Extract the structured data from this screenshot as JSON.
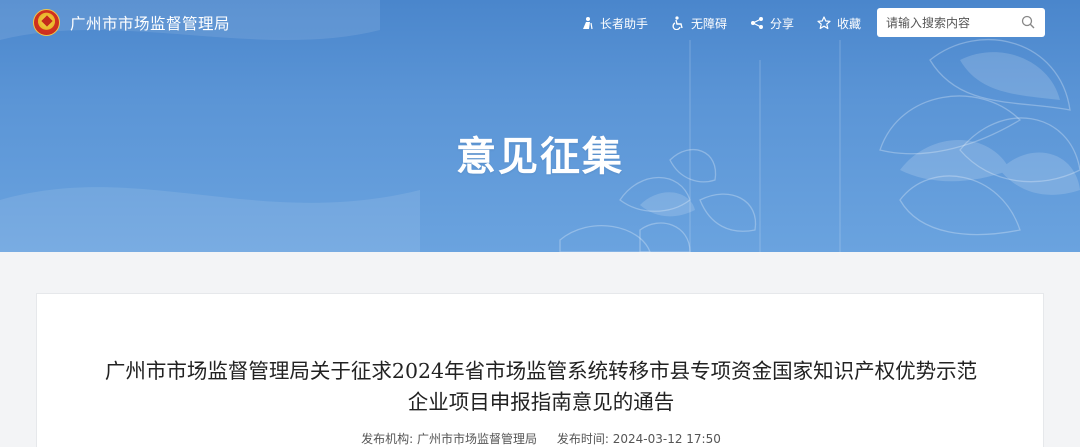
{
  "header": {
    "site_name": "广州市市场监督管理局",
    "tools": [
      {
        "label": "长者助手",
        "icon": "elder-assistant-icon"
      },
      {
        "label": "无障碍",
        "icon": "accessibility-icon"
      },
      {
        "label": "分享",
        "icon": "share-icon"
      },
      {
        "label": "收藏",
        "icon": "star-icon"
      }
    ],
    "search": {
      "placeholder": "请输入搜索内容",
      "value": ""
    }
  },
  "banner": {
    "title": "意见征集"
  },
  "article": {
    "title": "广州市市场监督管理局关于征求2024年省市场监管系统转移市县专项资金国家知识产权优势示范企业项目申报指南意见的通告",
    "publisher_label": "发布机构:",
    "publisher": "广州市市场监督管理局",
    "time_label": "发布时间:",
    "time": "2024-03-12 17:50"
  },
  "colors": {
    "banner": "#5b95d6",
    "text": "#222222",
    "background": "#f3f4f6"
  }
}
